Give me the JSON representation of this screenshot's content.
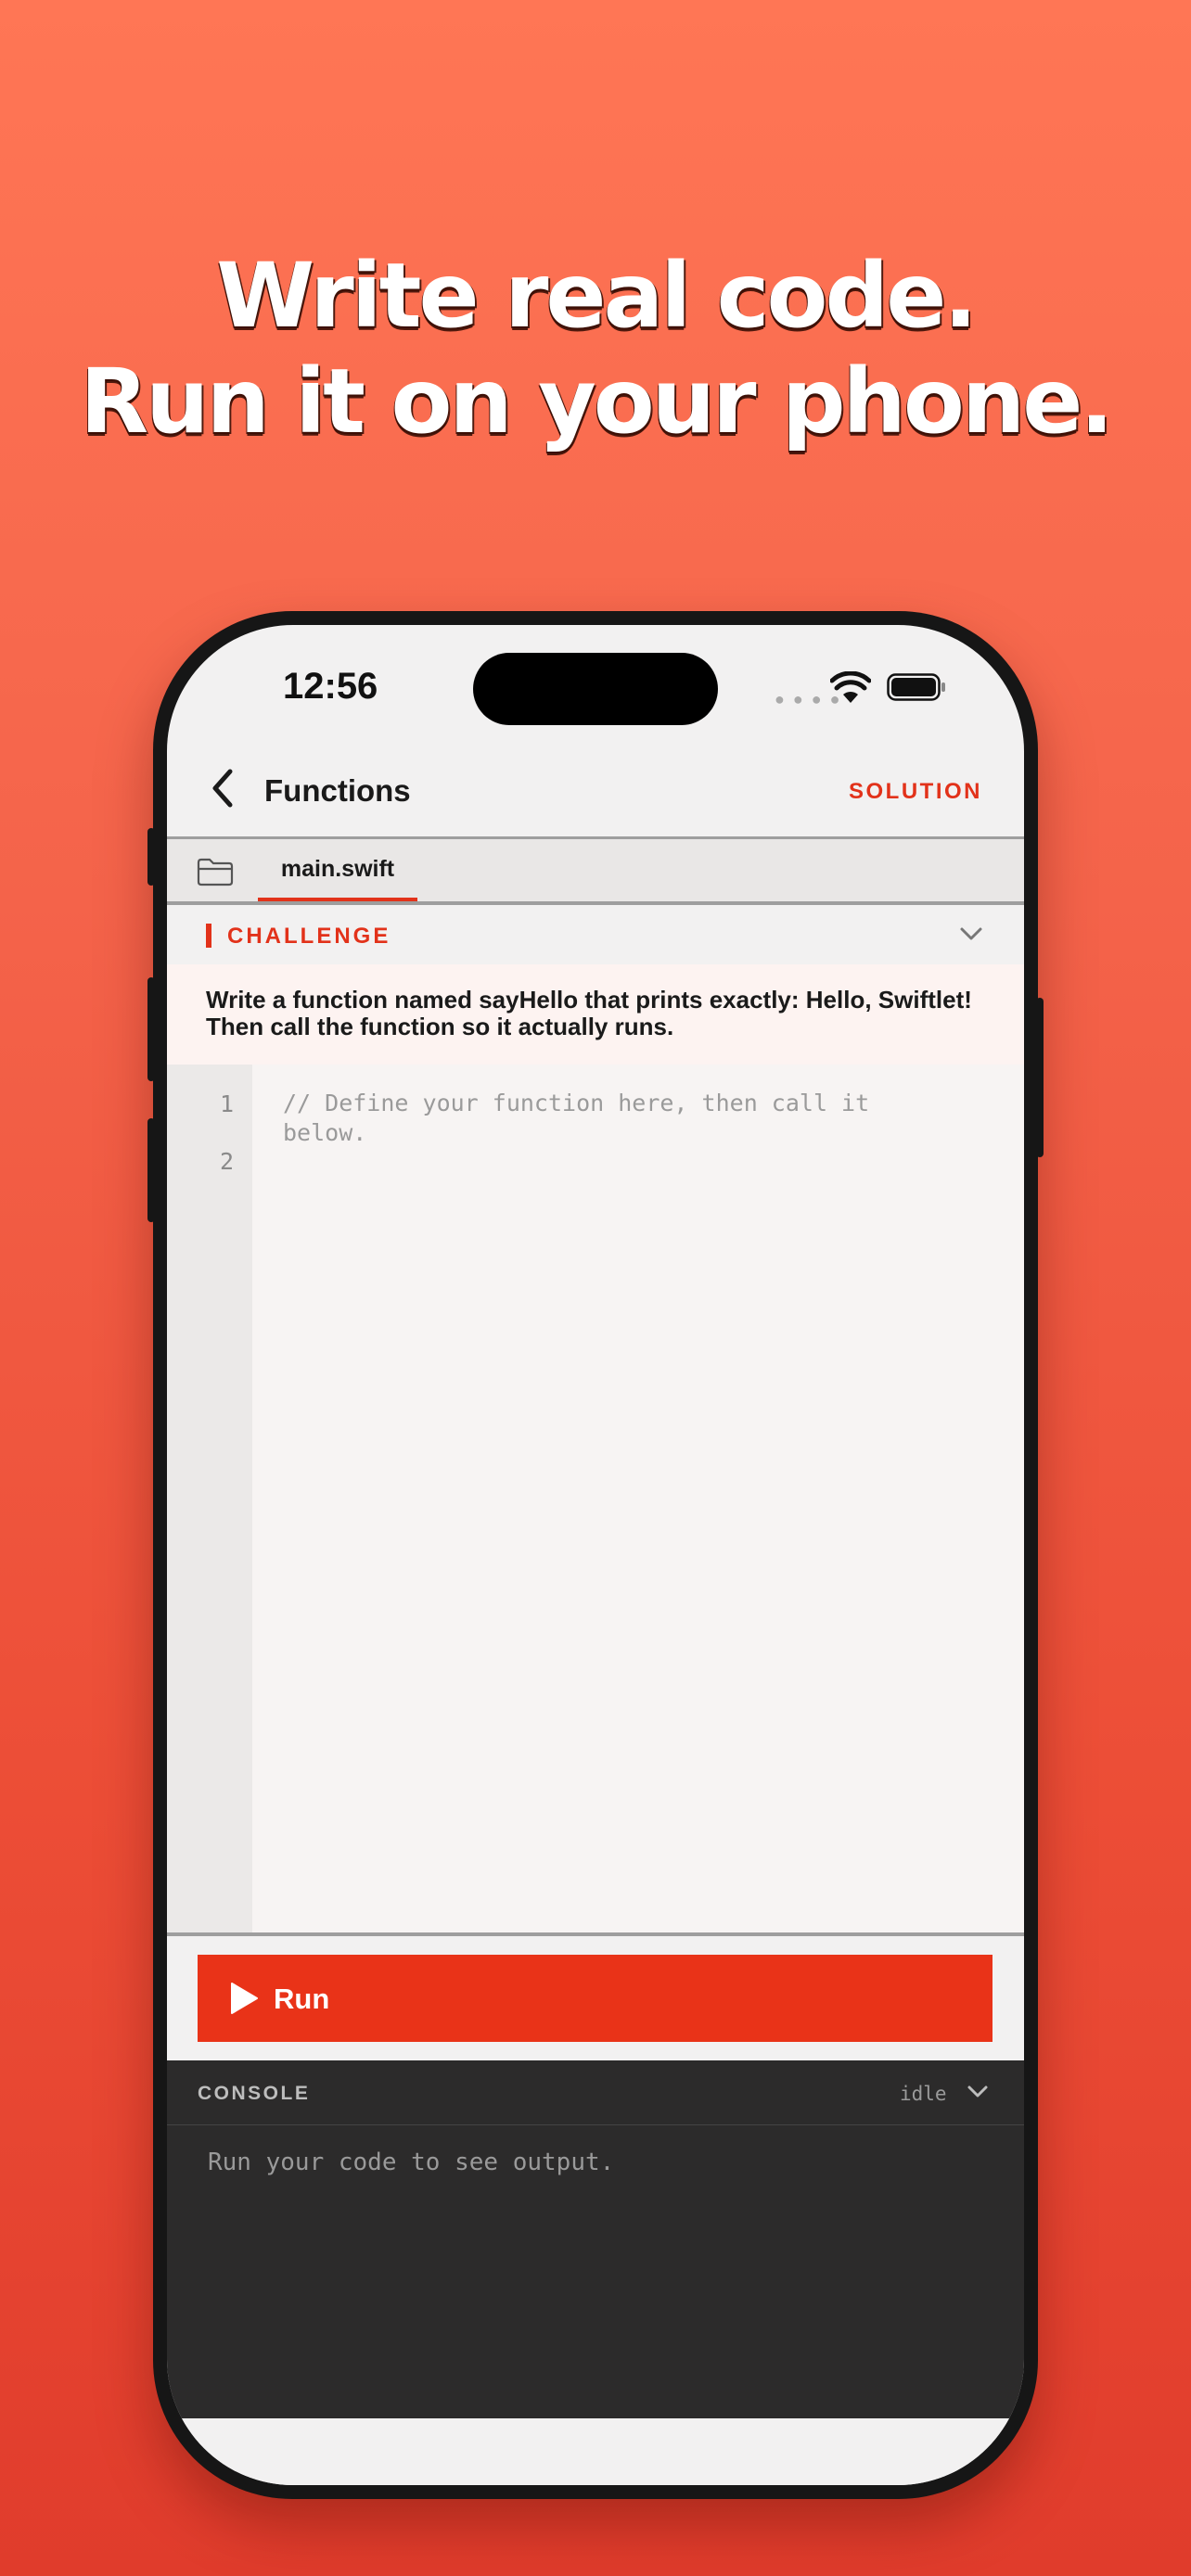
{
  "headline": {
    "line1": "Write real code.",
    "line2": "Run it on your phone."
  },
  "status_bar": {
    "time": "12:56",
    "icons": [
      "cellular-signal-icon",
      "wifi-icon",
      "battery-icon"
    ]
  },
  "nav": {
    "back_icon": "chevron-left-icon",
    "title": "Functions",
    "solution_label": "SOLUTION"
  },
  "tabs": {
    "folder_icon": "folder-icon",
    "active_file": "main.swift"
  },
  "challenge": {
    "title": "CHALLENGE",
    "line1": "Write a function named sayHello that prints exactly: Hello, Swiftlet!",
    "line2": "Then call the function so it actually runs.",
    "chevron_icon": "chevron-down-icon"
  },
  "editor": {
    "line_numbers": [
      "1",
      "2"
    ],
    "placeholder": "// Define your function here, then call it below."
  },
  "run": {
    "icon": "play-icon",
    "label": "Run"
  },
  "console": {
    "title": "CONSOLE",
    "status": "idle",
    "output": "Run your code to see output.",
    "chevron_icon": "chevron-down-icon"
  },
  "colors": {
    "accent": "#e2321a",
    "run_button": "#e93318",
    "console_bg": "#2c2b2b",
    "background_top": "#ff7655",
    "background_bottom": "#e03c2c"
  }
}
